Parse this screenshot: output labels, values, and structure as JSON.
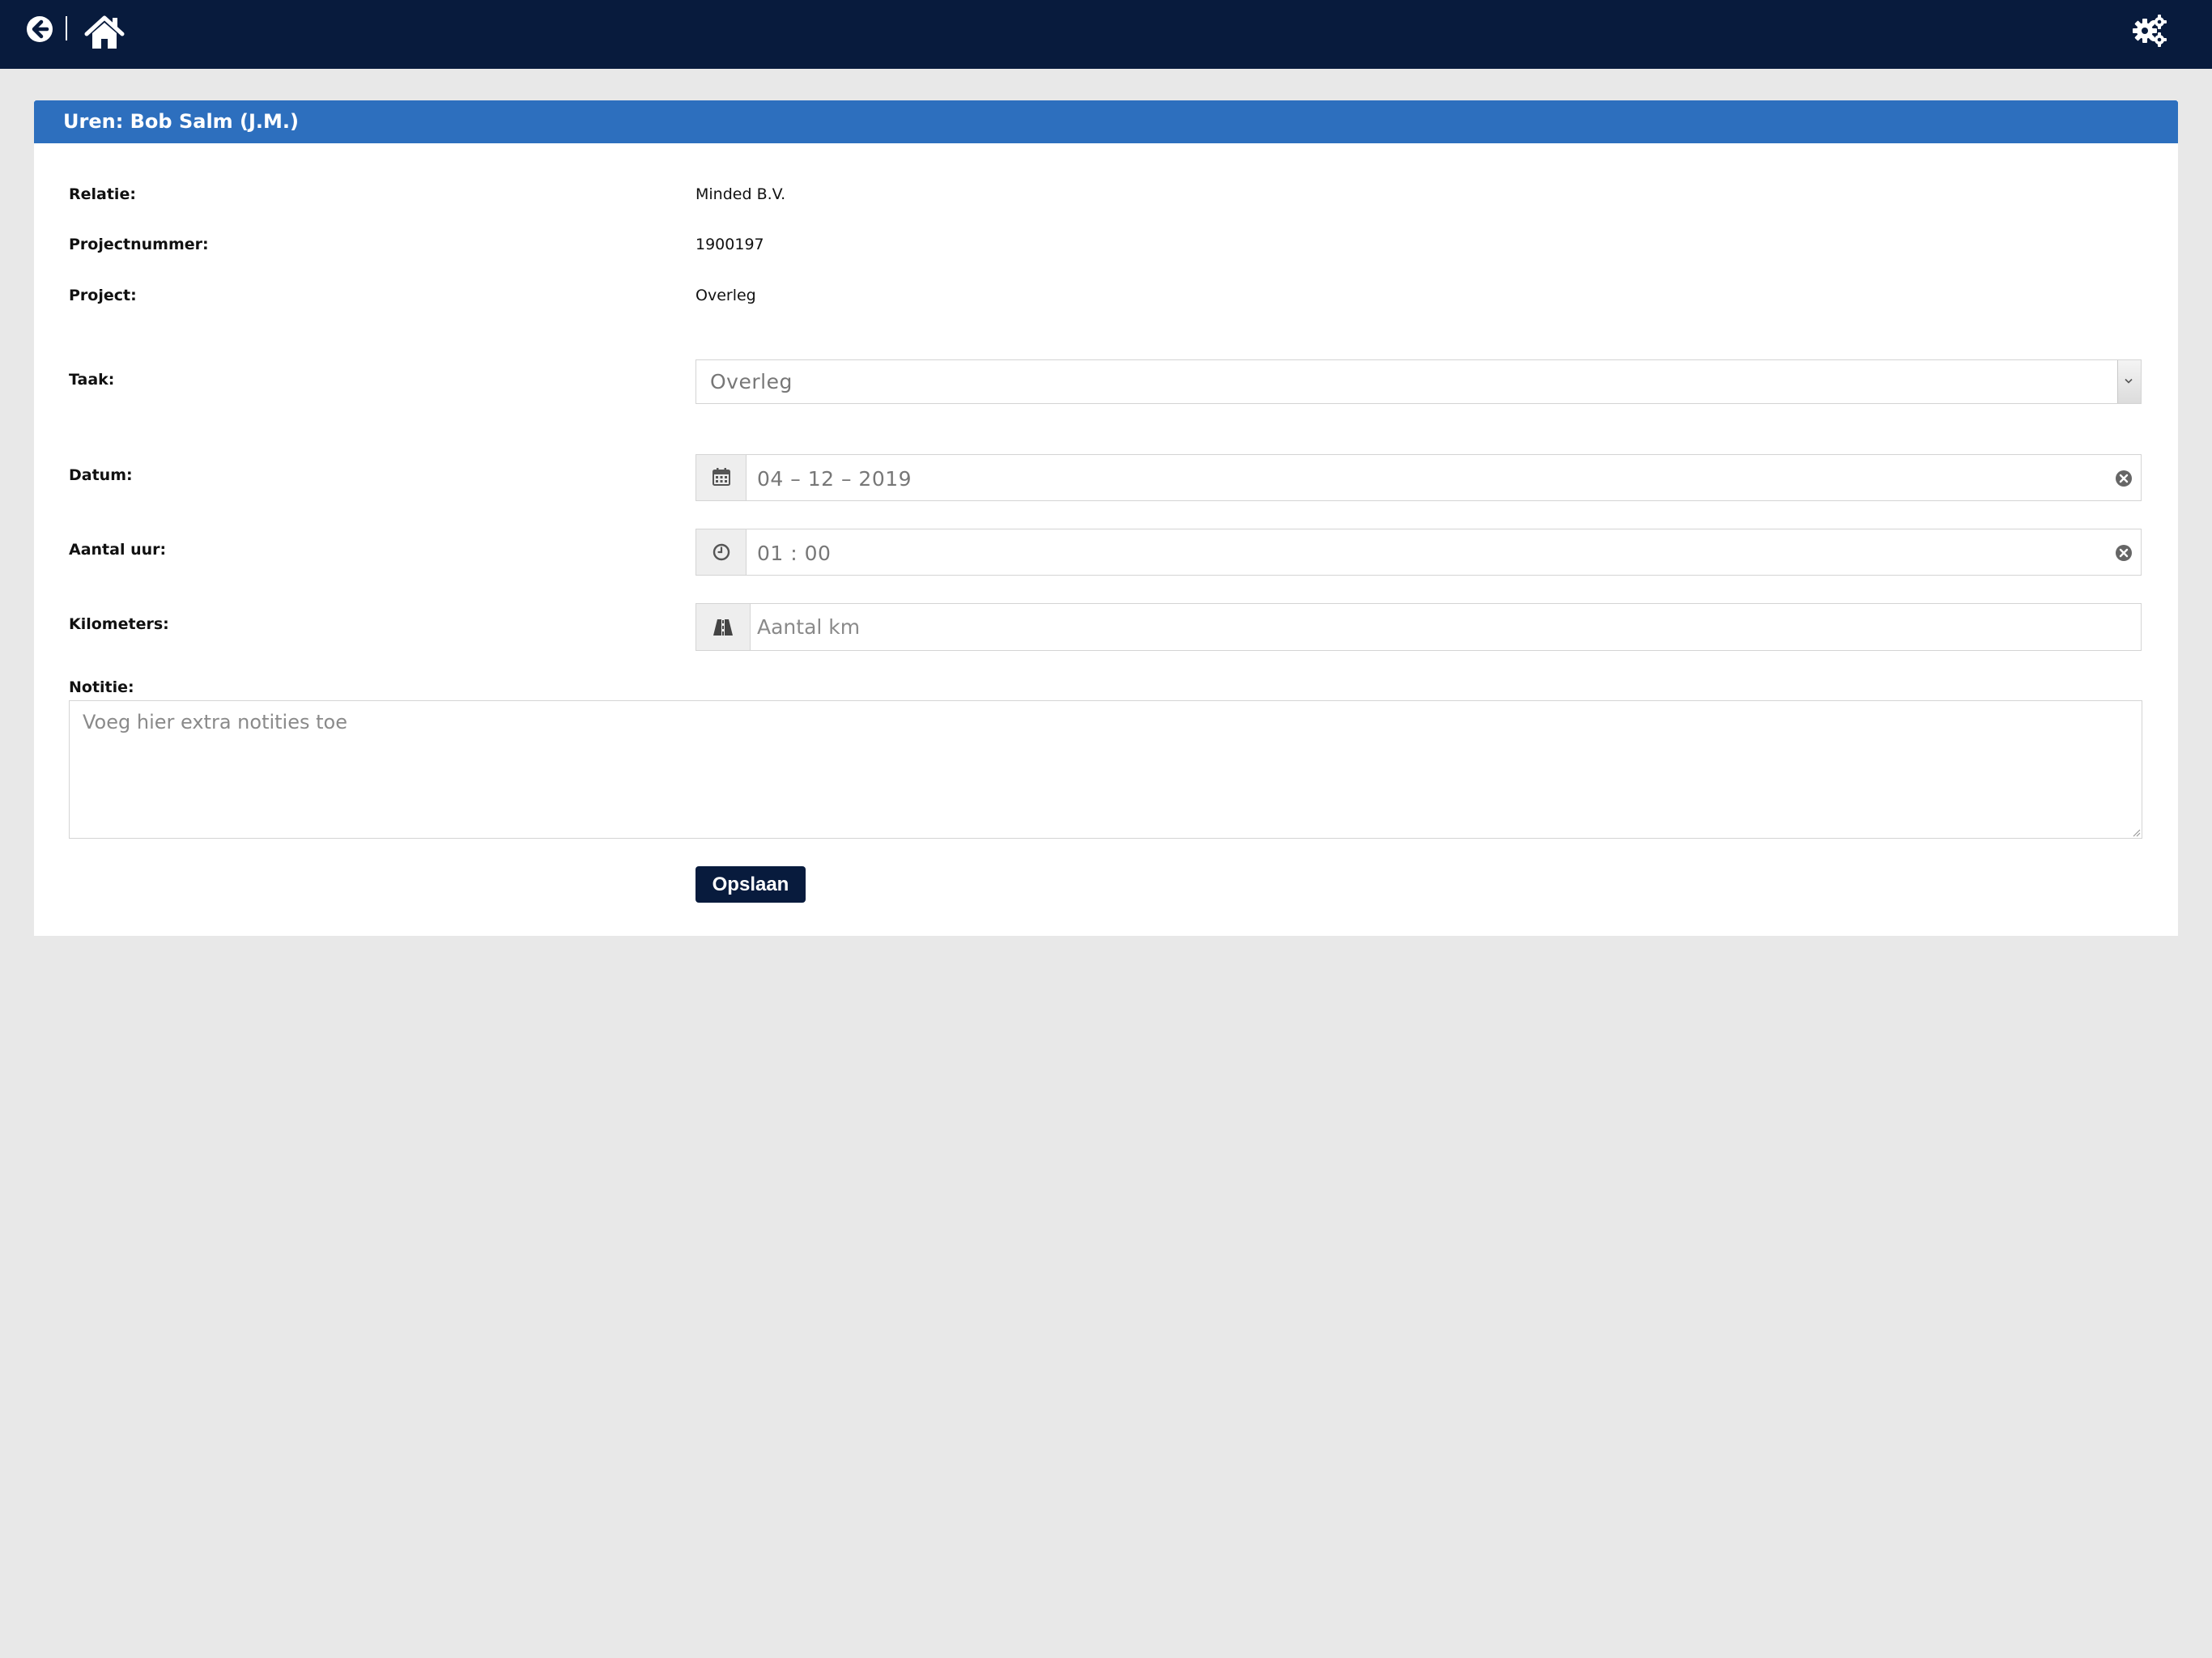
{
  "topbar": {
    "back_icon": "back-arrow-circle-icon",
    "home_icon": "home-icon",
    "settings_icon": "gears-icon",
    "background": "#081b3d"
  },
  "panel": {
    "title": "Uren: Bob Salm (J.M.)",
    "header_color": "#2d6fbe"
  },
  "details": {
    "relatie_label": "Relatie:",
    "relatie_value": "Minded B.V.",
    "projectnummer_label": "Projectnummer:",
    "projectnummer_value": "1900197",
    "project_label": "Project:",
    "project_value": "Overleg"
  },
  "form": {
    "taak_label": "Taak:",
    "taak_value": "Overleg",
    "datum_label": "Datum:",
    "datum_value": "04 – 12 – 2019",
    "datum_icon": "calendar-icon",
    "aantal_uur_label": "Aantal uur:",
    "aantal_uur_value": "01 : 00",
    "aantal_uur_icon": "clock-icon",
    "kilometers_label": "Kilometers:",
    "kilometers_placeholder": "Aantal km",
    "kilometers_icon": "road-icon",
    "notitie_label": "Notitie:",
    "notitie_placeholder": "Voeg hier extra notities toe",
    "save_label": "Opslaan",
    "save_color": "#081b3d"
  }
}
